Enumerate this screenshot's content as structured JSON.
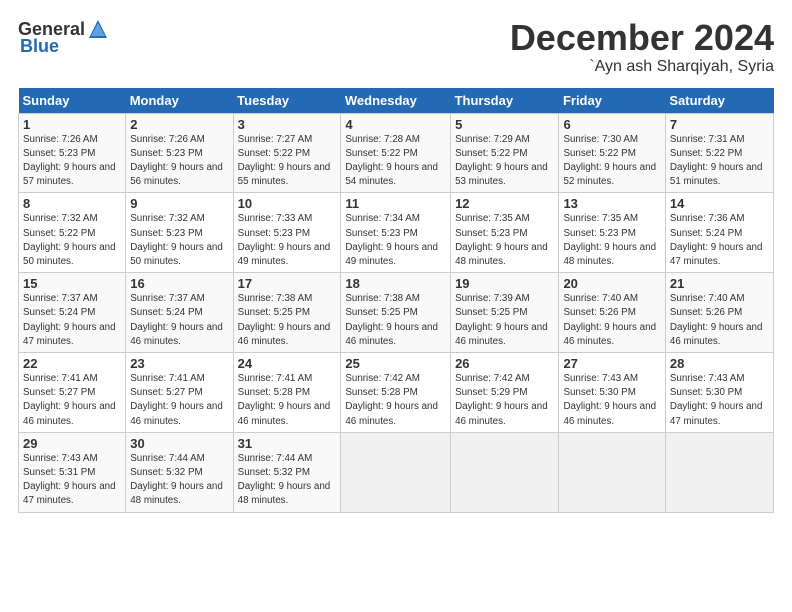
{
  "logo": {
    "general": "General",
    "blue": "Blue"
  },
  "header": {
    "month": "December 2024",
    "location": "`Ayn ash Sharqiyah, Syria"
  },
  "weekdays": [
    "Sunday",
    "Monday",
    "Tuesday",
    "Wednesday",
    "Thursday",
    "Friday",
    "Saturday"
  ],
  "weeks": [
    [
      {
        "day": "1",
        "sunrise": "Sunrise: 7:26 AM",
        "sunset": "Sunset: 5:23 PM",
        "daylight": "Daylight: 9 hours and 57 minutes."
      },
      {
        "day": "2",
        "sunrise": "Sunrise: 7:26 AM",
        "sunset": "Sunset: 5:23 PM",
        "daylight": "Daylight: 9 hours and 56 minutes."
      },
      {
        "day": "3",
        "sunrise": "Sunrise: 7:27 AM",
        "sunset": "Sunset: 5:22 PM",
        "daylight": "Daylight: 9 hours and 55 minutes."
      },
      {
        "day": "4",
        "sunrise": "Sunrise: 7:28 AM",
        "sunset": "Sunset: 5:22 PM",
        "daylight": "Daylight: 9 hours and 54 minutes."
      },
      {
        "day": "5",
        "sunrise": "Sunrise: 7:29 AM",
        "sunset": "Sunset: 5:22 PM",
        "daylight": "Daylight: 9 hours and 53 minutes."
      },
      {
        "day": "6",
        "sunrise": "Sunrise: 7:30 AM",
        "sunset": "Sunset: 5:22 PM",
        "daylight": "Daylight: 9 hours and 52 minutes."
      },
      {
        "day": "7",
        "sunrise": "Sunrise: 7:31 AM",
        "sunset": "Sunset: 5:22 PM",
        "daylight": "Daylight: 9 hours and 51 minutes."
      }
    ],
    [
      {
        "day": "8",
        "sunrise": "Sunrise: 7:32 AM",
        "sunset": "Sunset: 5:22 PM",
        "daylight": "Daylight: 9 hours and 50 minutes."
      },
      {
        "day": "9",
        "sunrise": "Sunrise: 7:32 AM",
        "sunset": "Sunset: 5:23 PM",
        "daylight": "Daylight: 9 hours and 50 minutes."
      },
      {
        "day": "10",
        "sunrise": "Sunrise: 7:33 AM",
        "sunset": "Sunset: 5:23 PM",
        "daylight": "Daylight: 9 hours and 49 minutes."
      },
      {
        "day": "11",
        "sunrise": "Sunrise: 7:34 AM",
        "sunset": "Sunset: 5:23 PM",
        "daylight": "Daylight: 9 hours and 49 minutes."
      },
      {
        "day": "12",
        "sunrise": "Sunrise: 7:35 AM",
        "sunset": "Sunset: 5:23 PM",
        "daylight": "Daylight: 9 hours and 48 minutes."
      },
      {
        "day": "13",
        "sunrise": "Sunrise: 7:35 AM",
        "sunset": "Sunset: 5:23 PM",
        "daylight": "Daylight: 9 hours and 48 minutes."
      },
      {
        "day": "14",
        "sunrise": "Sunrise: 7:36 AM",
        "sunset": "Sunset: 5:24 PM",
        "daylight": "Daylight: 9 hours and 47 minutes."
      }
    ],
    [
      {
        "day": "15",
        "sunrise": "Sunrise: 7:37 AM",
        "sunset": "Sunset: 5:24 PM",
        "daylight": "Daylight: 9 hours and 47 minutes."
      },
      {
        "day": "16",
        "sunrise": "Sunrise: 7:37 AM",
        "sunset": "Sunset: 5:24 PM",
        "daylight": "Daylight: 9 hours and 46 minutes."
      },
      {
        "day": "17",
        "sunrise": "Sunrise: 7:38 AM",
        "sunset": "Sunset: 5:25 PM",
        "daylight": "Daylight: 9 hours and 46 minutes."
      },
      {
        "day": "18",
        "sunrise": "Sunrise: 7:38 AM",
        "sunset": "Sunset: 5:25 PM",
        "daylight": "Daylight: 9 hours and 46 minutes."
      },
      {
        "day": "19",
        "sunrise": "Sunrise: 7:39 AM",
        "sunset": "Sunset: 5:25 PM",
        "daylight": "Daylight: 9 hours and 46 minutes."
      },
      {
        "day": "20",
        "sunrise": "Sunrise: 7:40 AM",
        "sunset": "Sunset: 5:26 PM",
        "daylight": "Daylight: 9 hours and 46 minutes."
      },
      {
        "day": "21",
        "sunrise": "Sunrise: 7:40 AM",
        "sunset": "Sunset: 5:26 PM",
        "daylight": "Daylight: 9 hours and 46 minutes."
      }
    ],
    [
      {
        "day": "22",
        "sunrise": "Sunrise: 7:41 AM",
        "sunset": "Sunset: 5:27 PM",
        "daylight": "Daylight: 9 hours and 46 minutes."
      },
      {
        "day": "23",
        "sunrise": "Sunrise: 7:41 AM",
        "sunset": "Sunset: 5:27 PM",
        "daylight": "Daylight: 9 hours and 46 minutes."
      },
      {
        "day": "24",
        "sunrise": "Sunrise: 7:41 AM",
        "sunset": "Sunset: 5:28 PM",
        "daylight": "Daylight: 9 hours and 46 minutes."
      },
      {
        "day": "25",
        "sunrise": "Sunrise: 7:42 AM",
        "sunset": "Sunset: 5:28 PM",
        "daylight": "Daylight: 9 hours and 46 minutes."
      },
      {
        "day": "26",
        "sunrise": "Sunrise: 7:42 AM",
        "sunset": "Sunset: 5:29 PM",
        "daylight": "Daylight: 9 hours and 46 minutes."
      },
      {
        "day": "27",
        "sunrise": "Sunrise: 7:43 AM",
        "sunset": "Sunset: 5:30 PM",
        "daylight": "Daylight: 9 hours and 46 minutes."
      },
      {
        "day": "28",
        "sunrise": "Sunrise: 7:43 AM",
        "sunset": "Sunset: 5:30 PM",
        "daylight": "Daylight: 9 hours and 47 minutes."
      }
    ],
    [
      {
        "day": "29",
        "sunrise": "Sunrise: 7:43 AM",
        "sunset": "Sunset: 5:31 PM",
        "daylight": "Daylight: 9 hours and 47 minutes."
      },
      {
        "day": "30",
        "sunrise": "Sunrise: 7:44 AM",
        "sunset": "Sunset: 5:32 PM",
        "daylight": "Daylight: 9 hours and 48 minutes."
      },
      {
        "day": "31",
        "sunrise": "Sunrise: 7:44 AM",
        "sunset": "Sunset: 5:32 PM",
        "daylight": "Daylight: 9 hours and 48 minutes."
      },
      null,
      null,
      null,
      null
    ]
  ]
}
